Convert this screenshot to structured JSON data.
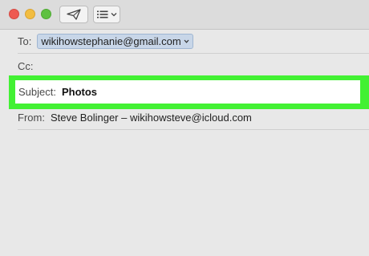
{
  "compose": {
    "to_label": "To:",
    "to_recipient": "wikihowstephanie@gmail.com",
    "cc_label": "Cc:",
    "subject_label": "Subject:",
    "subject_value": "Photos",
    "from_label": "From:",
    "from_value": "Steve Bolinger – wikihowsteve@icloud.com"
  },
  "icons": {
    "send": "paper-plane-icon",
    "format": "list-format-icon",
    "chevron": "chevron-down-icon"
  },
  "colors": {
    "highlight": "#42f133",
    "close": "#ee5a52",
    "minimize": "#f2bd41",
    "maximize": "#5ec140",
    "token": "#c8d6e8"
  }
}
